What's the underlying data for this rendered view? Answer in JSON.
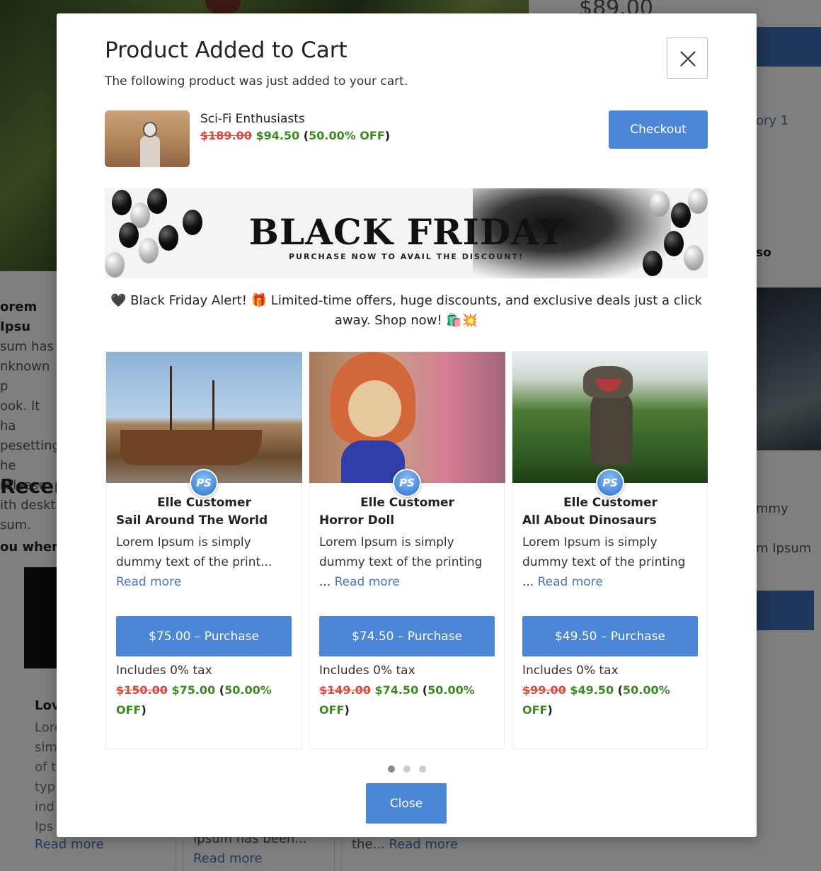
{
  "background": {
    "price": "$89.00",
    "right_link": "ory 1",
    "right_bold": "so",
    "right_text1": "mmy",
    "right_text2": "m Ipsum",
    "left_bold": "orem Ipsu",
    "left_lines": [
      "sum has",
      "nknown p",
      "ook. It ha",
      "pesetting",
      "he release",
      "ith deskt",
      "sum."
    ],
    "recent": "Recent",
    "where": "ou where",
    "lov": "Lov",
    "col1_lines": [
      "Lore",
      "sim",
      "of t",
      "typ",
      "ind",
      "Ips"
    ],
    "read_more": "Read more",
    "col2_text": "Ipsum has been...",
    "col3_text": "the...",
    "col3_link": "Read more"
  },
  "modal": {
    "title": "Product Added to Cart",
    "subtitle": "The following product was just added to your cart.",
    "product": {
      "name": "Sci-Fi Enthusiasts",
      "old_price": "$189.00",
      "new_price": "$94.50",
      "discount": "50.00% OFF"
    },
    "checkout_label": "Checkout",
    "banner": {
      "title": "BLACK FRIDAY",
      "tagline": "PURCHASE NOW TO AVAIL THE DISCOUNT!"
    },
    "alert_text": "🖤 Black Friday Alert! 🎁 Limited-time offers, huge discounts, and exclusive deals just a click away. Shop now! 🛍️💥",
    "cards": [
      {
        "author": "Elle Customer",
        "title": "Sail Around The World",
        "desc": "Lorem Ipsum is simply dummy text of the print...",
        "read_more": "Read more",
        "button": "$75.00 – Purchase",
        "tax": "Includes 0% tax",
        "old_price": "$150.00",
        "new_price": "$75.00",
        "discount": "50.00% OFF"
      },
      {
        "author": "Elle Customer",
        "title": "Horror Doll",
        "desc": "Lorem Ipsum is simply dummy text of the printing ...",
        "read_more": "Read more",
        "button": "$74.50 – Purchase",
        "tax": "Includes 0% tax",
        "old_price": "$149.00",
        "new_price": "$74.50",
        "discount": "50.00% OFF"
      },
      {
        "author": "Elle Customer",
        "title": "All About Dinosaurs",
        "desc": "Lorem Ipsum is simply dummy text of the printing ...",
        "read_more": "Read more",
        "button": "$49.50 – Purchase",
        "tax": "Includes 0% tax",
        "old_price": "$99.00",
        "new_price": "$49.50",
        "discount": "50.00% OFF"
      }
    ],
    "avatar_text": "PS",
    "pagination": {
      "count": 3,
      "active": 1
    },
    "close_label": "Close"
  },
  "colors": {
    "primary": "#4c86d6",
    "strike_red": "#e0463b",
    "discount_green": "#3a8a22",
    "link": "#4a76b8"
  }
}
